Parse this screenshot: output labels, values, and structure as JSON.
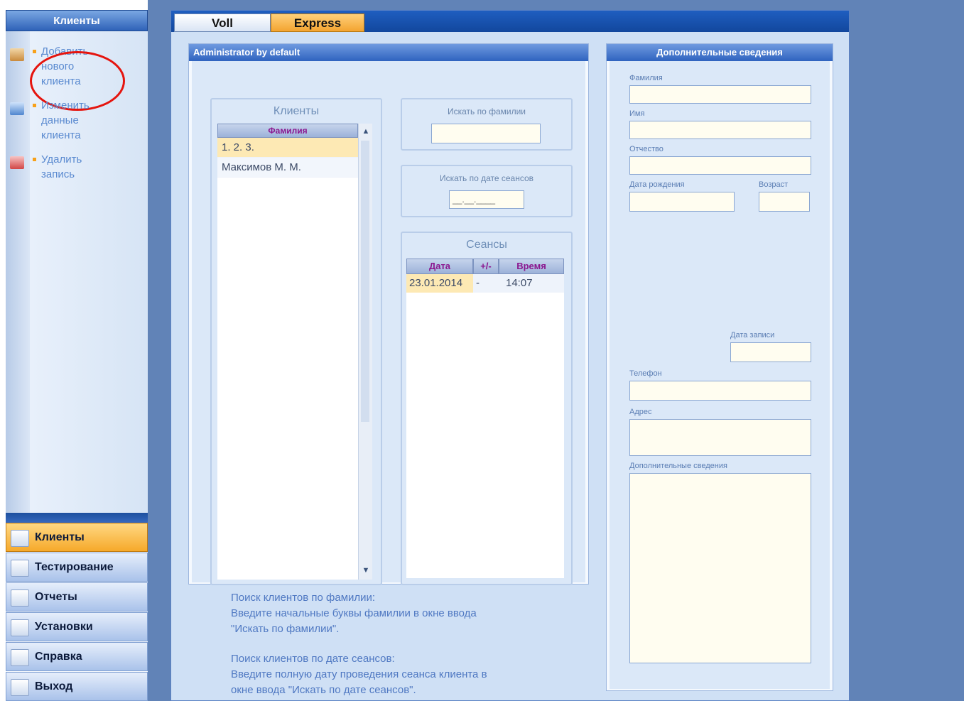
{
  "left_pane": {
    "header": "Клиенты",
    "tasks": [
      {
        "label": "Добавить нового клиента",
        "icon": "add-client-icon"
      },
      {
        "label": "Изменить данные клиента",
        "icon": "edit-client-icon"
      },
      {
        "label": "Удалить запись",
        "icon": "delete-record-icon"
      }
    ],
    "nav": [
      {
        "label": "Клиенты",
        "icon": "clients-icon",
        "active": true
      },
      {
        "label": "Тестирование",
        "icon": "testing-icon",
        "active": false
      },
      {
        "label": "Отчеты",
        "icon": "reports-icon",
        "active": false
      },
      {
        "label": "Установки",
        "icon": "settings-icon",
        "active": false
      },
      {
        "label": "Справка",
        "icon": "help-icon",
        "active": false
      },
      {
        "label": "Выход",
        "icon": "exit-icon",
        "active": false
      }
    ]
  },
  "tabs": [
    "Voll",
    "Express"
  ],
  "admin_panel": {
    "title": "Administrator by default",
    "clients": {
      "caption": "Клиенты",
      "column": "Фамилия",
      "rows": [
        "1. 2. 3.",
        "Максимов  М. М."
      ]
    },
    "search_surname": {
      "caption": "Искать по фамилии",
      "value": ""
    },
    "search_date": {
      "caption": "Искать по дате сеансов",
      "value": "__.__.____"
    },
    "sessions": {
      "caption": "Сеансы",
      "columns": [
        "Дата",
        "+/-",
        "Время"
      ],
      "rows": [
        {
          "date": "23.01.2014",
          "pm": "-",
          "time": "14:07"
        }
      ]
    }
  },
  "help_text": {
    "para1": [
      "Поиск клиентов по фамилии:",
      "Введите начальные буквы фамилии в окне ввода",
      "\"Искать по фамилии\"."
    ],
    "para2": [
      "Поиск клиентов по дате сеансов:",
      "Введите полную дату проведения сеанса клиента в",
      "окне ввода \"Искать по дате сеансов\"."
    ]
  },
  "info_panel": {
    "title": "Дополнительные сведения",
    "labels": {
      "surname": "Фамилия",
      "name": "Имя",
      "patronymic": "Отчество",
      "birthdate": "Дата рождения",
      "age": "Возраст",
      "record_date": "Дата записи",
      "phone": "Телефон",
      "address": "Адрес",
      "extra": "Дополнительные сведения"
    }
  },
  "colors": {
    "accent_orange": "#f6a92a",
    "title_blue": "#2f63bf",
    "highlight_red": "#e5140e"
  }
}
